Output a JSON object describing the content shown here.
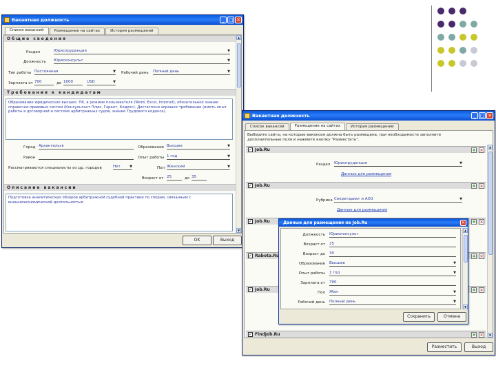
{
  "decor": {
    "colors": [
      "#4a2a6b",
      "#7fa9a5",
      "#c9c62a",
      "#c9c9d6"
    ]
  },
  "win1": {
    "title": "Вакантная должность",
    "tabs": [
      "Список вакансий",
      "Размещение на сайтах",
      "История размещений"
    ],
    "sections": {
      "general": "Общие сведения",
      "requirements": "Требования к кандидатам",
      "description": "Описание вакансии"
    },
    "general": {
      "city_label": "Раздел",
      "city_value": "Юриспруденция",
      "position_label": "Должность",
      "position_value": "Юрисконсульт",
      "schedule_label": "Тип работы",
      "schedule_value": "Постоянная",
      "workday_label": "Рабочий день",
      "workday_value": "Полный день",
      "salary_label": "Зарплата от",
      "salary_from": "700",
      "salary_to_label": "до",
      "salary_to": "1000",
      "currency": "USD"
    },
    "requirements_text": "Образование юридическое высшее. ПК, в режиме пользователя (Word, Excel, Internet), обязательное знание справочно-правовых систем (Консультант Плюс, Гарант, Кодекс). Достаточно хорошее требование (иметь опыт работы в договорной и системе арбитражных судов, знание Трудового кодекса).",
    "cand": {
      "city_label": "Город",
      "city_value": "Архангельск",
      "education_label": "Образование",
      "education_value": "Высшее",
      "district_label": "Район",
      "district_value": "",
      "experience_label": "Опыт работы",
      "experience_value": "1 год",
      "special_label": "Рассматриваются специалисты из др. городов",
      "special_value": "Нет",
      "sex_label": "Пол",
      "sex_value": "Женский",
      "age_label": "Возраст от",
      "age_from": "25",
      "age_to_label": "до",
      "age_to": "35"
    },
    "description_text": "Подготовка аналитических обзоров арбитражной судебной практики по спорам, связанным с внешнеэкономической деятельностью",
    "ok_label": "OK",
    "exit_label": "Выход"
  },
  "win2": {
    "title": "Вакантная должность",
    "tabs": [
      "Список вакансий",
      "Размещение на сайтах",
      "История размещений"
    ],
    "intro": "Выберите сайты, на которые вакансия должна быть размещена, при необходимости заполните дополнительные поля и нажмите кнопку \"Разместить\".",
    "sites": [
      {
        "name": "Job.Ru",
        "field_label": "Раздел",
        "field_value": "Юриспруденция",
        "link": "Данные для размещения"
      },
      {
        "name": "Job.Ru",
        "field_label": "Рубрика",
        "field_value": "Секретариат и АХО",
        "link": "Данные для размещения"
      },
      {
        "name": "Job.Ru"
      },
      {
        "name": "Rabota.Ru"
      },
      {
        "name": "Job.Ru"
      },
      {
        "name": "FindJob.Ru"
      }
    ],
    "place_label": "Разместить",
    "exit_label": "Выход"
  },
  "dialog": {
    "title": "Данные для размещения на Job.Ru",
    "fields": [
      {
        "label": "Должность",
        "value": "Юрисконсульт",
        "dropdown": false
      },
      {
        "label": "Возраст от",
        "value": "25",
        "dropdown": false
      },
      {
        "label": "Возраст до",
        "value": "30",
        "dropdown": false
      },
      {
        "label": "Образование",
        "value": "Высшее",
        "dropdown": true
      },
      {
        "label": "Опыт работы",
        "value": "1 год",
        "dropdown": true
      },
      {
        "label": "Зарплата от",
        "value": "700",
        "dropdown": false
      },
      {
        "label": "Пол",
        "value": "Жен",
        "dropdown": true
      },
      {
        "label": "Рабочий день",
        "value": "Полный день",
        "dropdown": true
      }
    ],
    "save_label": "Сохранить",
    "cancel_label": "Отмена"
  }
}
